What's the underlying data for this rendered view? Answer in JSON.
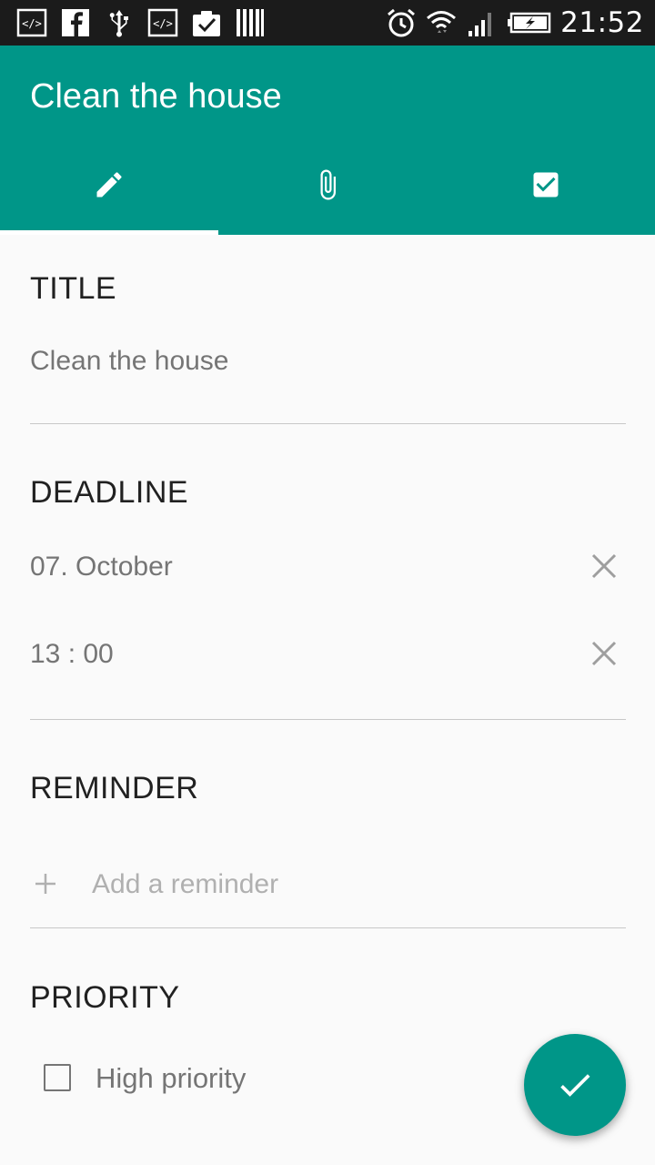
{
  "status_bar": {
    "time": "21:52",
    "left_icons": [
      "code-icon",
      "facebook-icon",
      "usb-icon",
      "code-icon",
      "clipboard-check-icon",
      "barcode-icon"
    ],
    "right_icons": [
      "alarm-icon",
      "wifi-icon",
      "signal-icon",
      "battery-charging-icon"
    ]
  },
  "app_bar": {
    "title": "Clean the house",
    "tabs": [
      {
        "icon": "pencil-icon",
        "active": true
      },
      {
        "icon": "paperclip-icon",
        "active": false
      },
      {
        "icon": "checkbox-icon",
        "active": false
      }
    ],
    "color": "#009688"
  },
  "form": {
    "title_section": {
      "header": "TITLE",
      "value": "Clean the house"
    },
    "deadline_section": {
      "header": "DEADLINE",
      "date": "07. October",
      "time": "13 : 00"
    },
    "reminder_section": {
      "header": "REMINDER",
      "add_label": "Add a reminder"
    },
    "priority_section": {
      "header": "PRIORITY",
      "checkbox_label": "High priority",
      "checked": false
    }
  },
  "fab": {
    "icon": "check-icon"
  }
}
